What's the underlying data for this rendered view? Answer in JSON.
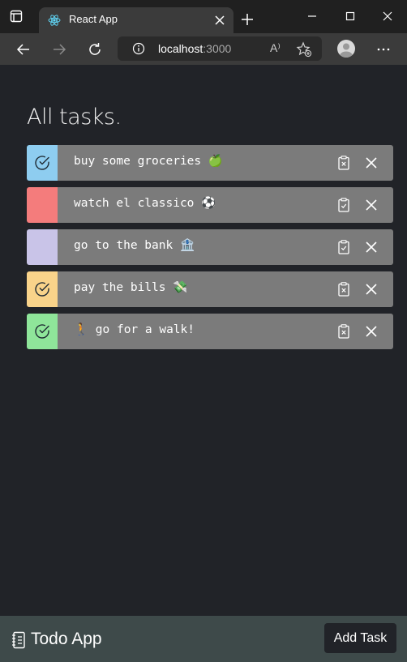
{
  "browser": {
    "tab_title": "React App",
    "url_host": "localhost",
    "url_port": ":3000",
    "read_aloud_glyph": "A⁾",
    "icons": [
      "window-menu-icon",
      "react-favicon-icon",
      "close-tab-icon",
      "new-tab-icon",
      "minimize-icon",
      "maximize-icon",
      "close-window-icon",
      "back-icon",
      "forward-icon",
      "refresh-icon",
      "info-icon",
      "read-aloud-icon",
      "favorites-add-icon",
      "profile-icon",
      "more-icon"
    ]
  },
  "main": {
    "title": "All tasks.",
    "tasks": [
      {
        "text": "buy some groceries 🍏",
        "color": "#8ecdf0",
        "done": true
      },
      {
        "text": "watch el classico ⚽",
        "color": "#f47c7c",
        "done": false
      },
      {
        "text": "go to the bank 🏦",
        "color": "#c9c4e8",
        "done": false
      },
      {
        "text": "pay the bills 💸",
        "color": "#f9d38a",
        "done": true
      },
      {
        "text": "🚶 go for a walk!",
        "color": "#8fe59a",
        "done": true
      }
    ]
  },
  "footer": {
    "app_name": "Todo App",
    "add_button": "Add Task"
  },
  "colors": {
    "page_bg": "#212328",
    "task_bg": "#7b7b7b",
    "footer_bg": "#3e4a4a"
  }
}
